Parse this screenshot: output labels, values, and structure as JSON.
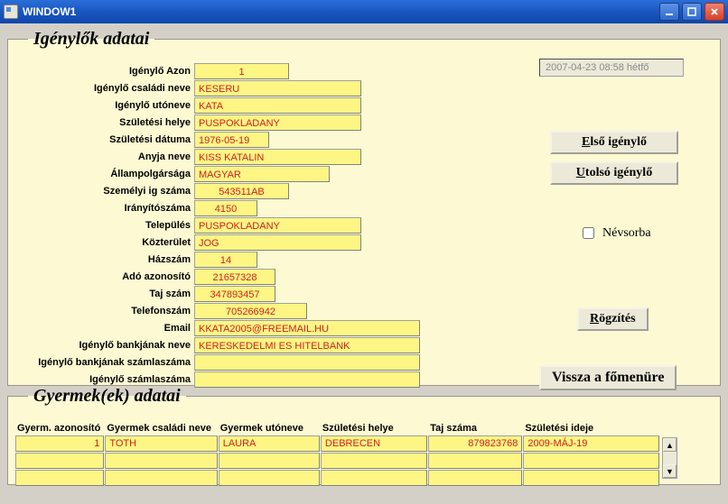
{
  "window": {
    "title": "WINDOW1"
  },
  "groups": {
    "applicants_title": "Igénylők adatai",
    "children_title": "Gyermek(ek) adatai"
  },
  "labels": {
    "azon": "Igénylő Azon",
    "csaladi": "Igénylő családi neve",
    "utoneve": "Igénylő utóneve",
    "szul_hely": "Születési helye",
    "szul_datum": "Születési dátuma",
    "anyja": "Anyja neve",
    "allampolg": "Állampolgársága",
    "szemig": "Személyi ig száma",
    "irsz": "Irányítószáma",
    "telepules": "Település",
    "kozterulet": "Közterület",
    "hazszam": "Házszám",
    "ado": "Adó azonosító",
    "taj": "Taj szám",
    "telefon": "Telefonszám",
    "email": "Email",
    "bank_nev": "Igénylő bankjának neve",
    "bank_szla": "Igénylő bankjának számlaszáma",
    "ig_szla": "Igénylő számlaszáma"
  },
  "values": {
    "azon": "1",
    "csaladi": "KESERU",
    "utoneve": "KATA",
    "szul_hely": "PUSPOKLADANY",
    "szul_datum": "1976-05-19",
    "anyja": "KISS KATALIN",
    "allampolg": "MAGYAR",
    "szemig": "543511AB",
    "irsz": "4150",
    "telepules": "PUSPOKLADANY",
    "kozterulet": "JOG",
    "hazszam": "14",
    "ado": "21657328",
    "taj": "347893457",
    "telefon": "705266942",
    "email": "KKATA2005@FREEMAIL.HU",
    "bank_nev": "KERESKEDELMI ES HITELBANK",
    "bank_szla": "",
    "ig_szla": ""
  },
  "side": {
    "datetime": "2007-04-23 08:58 hétfő",
    "first_btn": "lső igénylő",
    "first_prefix": "E",
    "last_btn": "tolsó igénylő",
    "last_prefix": "U",
    "nevsorba": "Névsorba",
    "rogzites": "ögzítés",
    "rogzites_prefix": "R",
    "vissza": "Vissza a főmenüre"
  },
  "children": {
    "headers": {
      "azon": "Gyerm. azonosító",
      "csaladi": "Gyermek családi neve",
      "utoneve": "Gyermek utóneve",
      "szul_hely": "Születési helye",
      "taj": "Taj száma",
      "szul_ido": "Születési ideje"
    },
    "rows": [
      {
        "azon": "1",
        "csaladi": "TOTH",
        "utoneve": "LAURA",
        "szul_hely": "DEBRECEN",
        "taj": "879823768",
        "szul_ido": "2009-MÁJ-19"
      },
      {
        "azon": "",
        "csaladi": "",
        "utoneve": "",
        "szul_hely": "",
        "taj": "",
        "szul_ido": ""
      },
      {
        "azon": "",
        "csaladi": "",
        "utoneve": "",
        "szul_hely": "",
        "taj": "",
        "szul_ido": ""
      }
    ]
  }
}
